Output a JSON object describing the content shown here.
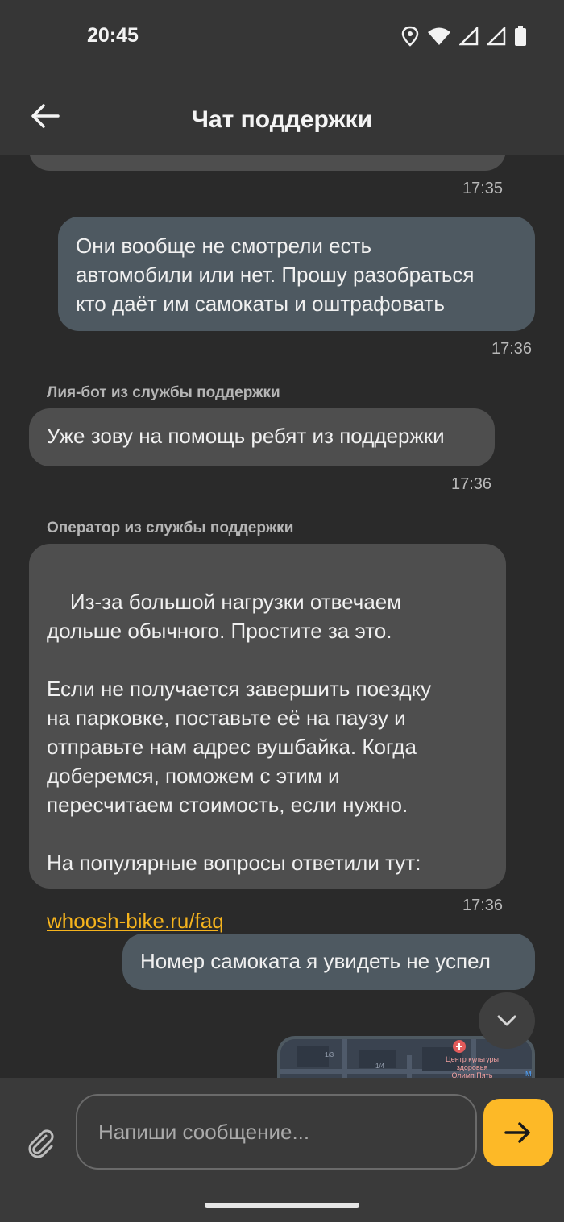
{
  "status_bar": {
    "time": "20:45"
  },
  "app_bar": {
    "title": "Чат поддержки"
  },
  "messages": [
    {
      "time": "17:35"
    },
    {
      "text": "Они вообще не смотрели есть\nавтомобили или нет. Прошу разобраться\nкто даёт им самокаты и оштрафовать",
      "time": "17:36"
    },
    {
      "sender": "Лия-бот из службы поддержки",
      "text": "Уже зову на помощь ребят из поддержки",
      "time": "17:36"
    },
    {
      "sender": "Оператор из службы поддержки",
      "text": "Из-за большой нагрузки отвечаем\nдольше обычного. Простите за это.\n\nЕсли не получается завершить поездку\nна парковке, поставьте её на паузу и\nотправьте нам адрес вушбайка. Когда\nдоберемся, поможем с этим и\nпересчитаем стоимость, если нужно.\n\nНа популярные вопросы ответили тут:",
      "link": "whoosh-bike.ru/faq",
      "time": "17:36"
    },
    {
      "text": "Номер самоката я увидеть не успел"
    }
  ],
  "map_preview": {
    "label_line1": "Центр культуры",
    "label_line2": "здоровья",
    "label_line3": "Олимп Пять",
    "marks": [
      "1/3",
      "1/4",
      "M"
    ]
  },
  "composer": {
    "placeholder": "Напиши сообщение..."
  },
  "colors": {
    "accent": "#fdb927",
    "link": "#f5b31d",
    "incoming": "#4e4e4e",
    "outgoing": "#4e5961"
  }
}
